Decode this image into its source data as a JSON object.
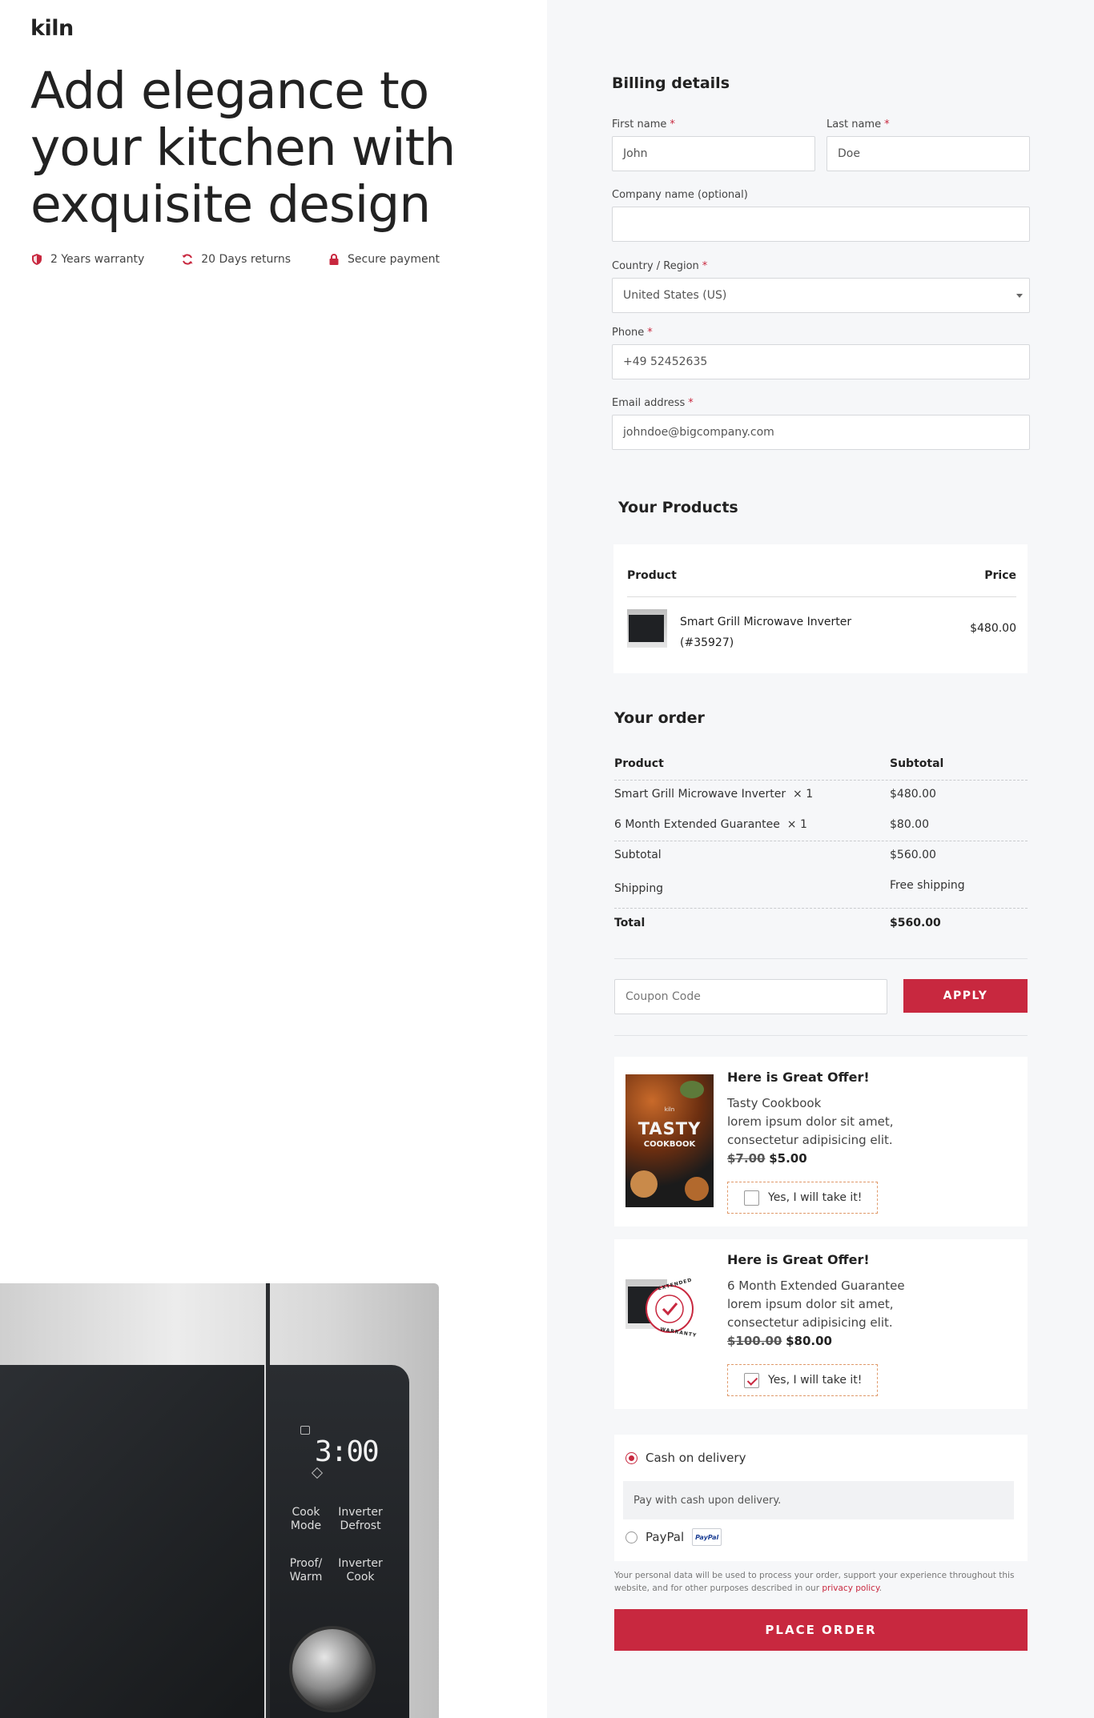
{
  "brand": {
    "logo": "kiln",
    "accent": "#c8283f"
  },
  "hero": {
    "title": "Add elegance to your kitchen with exquisite design",
    "features": [
      {
        "icon": "shield-icon",
        "label": "2 Years warranty"
      },
      {
        "icon": "refresh-icon",
        "label": "20 Days returns"
      },
      {
        "icon": "lock-icon",
        "label": "Secure payment"
      }
    ]
  },
  "microwave": {
    "display": "3:00",
    "buttons": [
      "Cook Mode",
      "Inverter Defrost",
      "Proof/ Warm",
      "Inverter Cook"
    ]
  },
  "billing": {
    "title": "Billing details",
    "first_name": {
      "label": "First name",
      "value": "John"
    },
    "last_name": {
      "label": "Last name",
      "value": "Doe"
    },
    "company": {
      "label": "Company name (optional)",
      "value": ""
    },
    "country": {
      "label": "Country / Region",
      "value": "United States (US)"
    },
    "phone": {
      "label": "Phone",
      "value": "+49 52452635"
    },
    "email": {
      "label": "Email address",
      "value": "johndoe@bigcompany.com"
    },
    "required_mark": "*"
  },
  "products": {
    "title": "Your Products",
    "col_product": "Product",
    "col_price": "Price",
    "items": [
      {
        "name": "Smart Grill Microwave Inverter",
        "sku": "(#35927)",
        "price": "$480.00"
      }
    ]
  },
  "order": {
    "title": "Your order",
    "col_product": "Product",
    "col_subtotal": "Subtotal",
    "lines": [
      {
        "name": "Smart Grill Microwave Inverter",
        "qty": "× 1",
        "amount": "$480.00"
      },
      {
        "name": "6 Month Extended Guarantee",
        "qty": "× 1",
        "amount": "$80.00"
      }
    ],
    "subtotal_label": "Subtotal",
    "subtotal": "$560.00",
    "shipping_label": "Shipping",
    "shipping": "Free shipping",
    "total_label": "Total",
    "total": "$560.00"
  },
  "coupon": {
    "placeholder": "Coupon Code",
    "button": "APPLY"
  },
  "offers": [
    {
      "title": "Here is Great Offer!",
      "name": "Tasty Cookbook",
      "desc": "lorem ipsum dolor sit amet, consectetur adipisicing elit.",
      "old_price": "$7.00",
      "new_price": "$5.00",
      "cta": "Yes, I will take it!",
      "checked": false,
      "image": {
        "logo": "kiln",
        "line1": "TASTY",
        "line2": "COOKBOOK"
      }
    },
    {
      "title": "Here is Great Offer!",
      "name": "6 Month Extended Guarantee",
      "desc": "lorem ipsum dolor sit amet, consectetur adipisicing elit.",
      "old_price": "$100.00",
      "new_price": "$80.00",
      "cta": "Yes, I will take it!",
      "checked": true,
      "image": {
        "badge_top": "EXTENDED",
        "badge_bottom": "WARRANTY"
      }
    }
  ],
  "payment": {
    "methods": [
      {
        "label": "Cash on delivery",
        "selected": true,
        "description": "Pay with cash upon delivery."
      },
      {
        "label": "PayPal",
        "selected": false,
        "badge": "PayPal"
      }
    ],
    "privacy_text": "Your personal data will be used to process your order, support your experience throughout this website, and for other purposes described in our",
    "privacy_link": "privacy policy",
    "privacy_end": ".",
    "place_order": "PLACE ORDER"
  }
}
